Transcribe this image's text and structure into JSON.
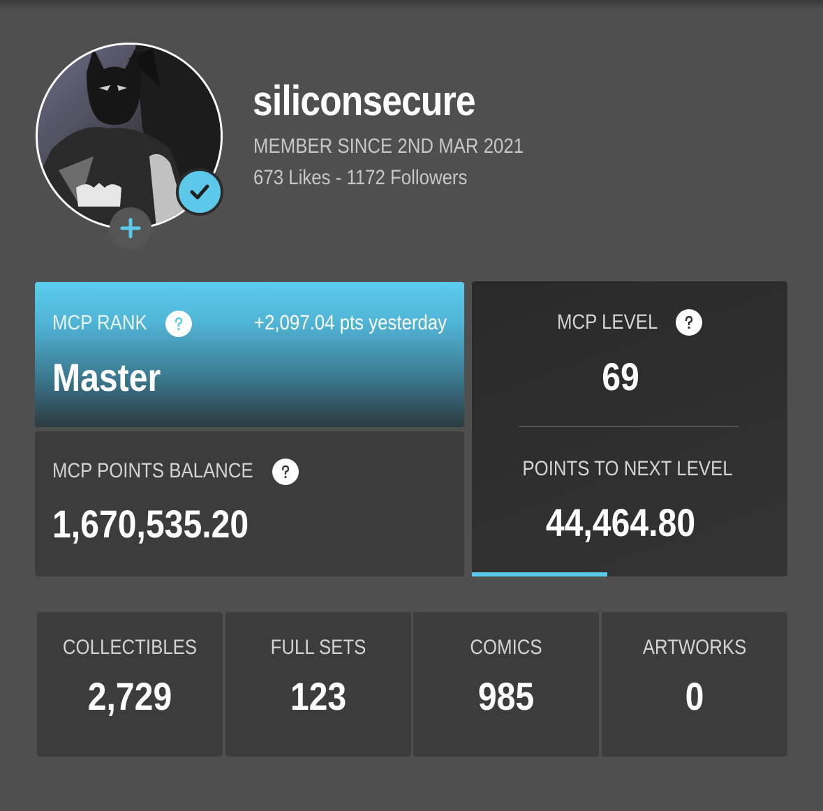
{
  "profile": {
    "username": "siliconsecure",
    "member_since": "MEMBER SINCE 2ND MAR 2021",
    "likes_followers": "673 Likes - 1172 Followers",
    "verified": true
  },
  "rank": {
    "label": "MCP RANK",
    "yesterday": "+2,097.04 pts yesterday",
    "value": "Master"
  },
  "balance": {
    "label": "MCP POINTS BALANCE",
    "value": "1,670,535.20"
  },
  "level": {
    "label": "MCP LEVEL",
    "value": "69",
    "next_label": "POINTS TO NEXT LEVEL",
    "next_value": "44,464.80",
    "progress_fraction": 0.43
  },
  "counters": [
    {
      "label": "COLLECTIBLES",
      "value": "2,729"
    },
    {
      "label": "FULL SETS",
      "value": "123"
    },
    {
      "label": "COMICS",
      "value": "985"
    },
    {
      "label": "ARTWORKS",
      "value": "0"
    }
  ],
  "colors": {
    "accent": "#5cc8ea",
    "background": "#4f4f4f",
    "card": "#3c3c3c"
  },
  "icons": {
    "verified": "check-icon",
    "follow": "plus-icon",
    "help": "question-icon"
  }
}
